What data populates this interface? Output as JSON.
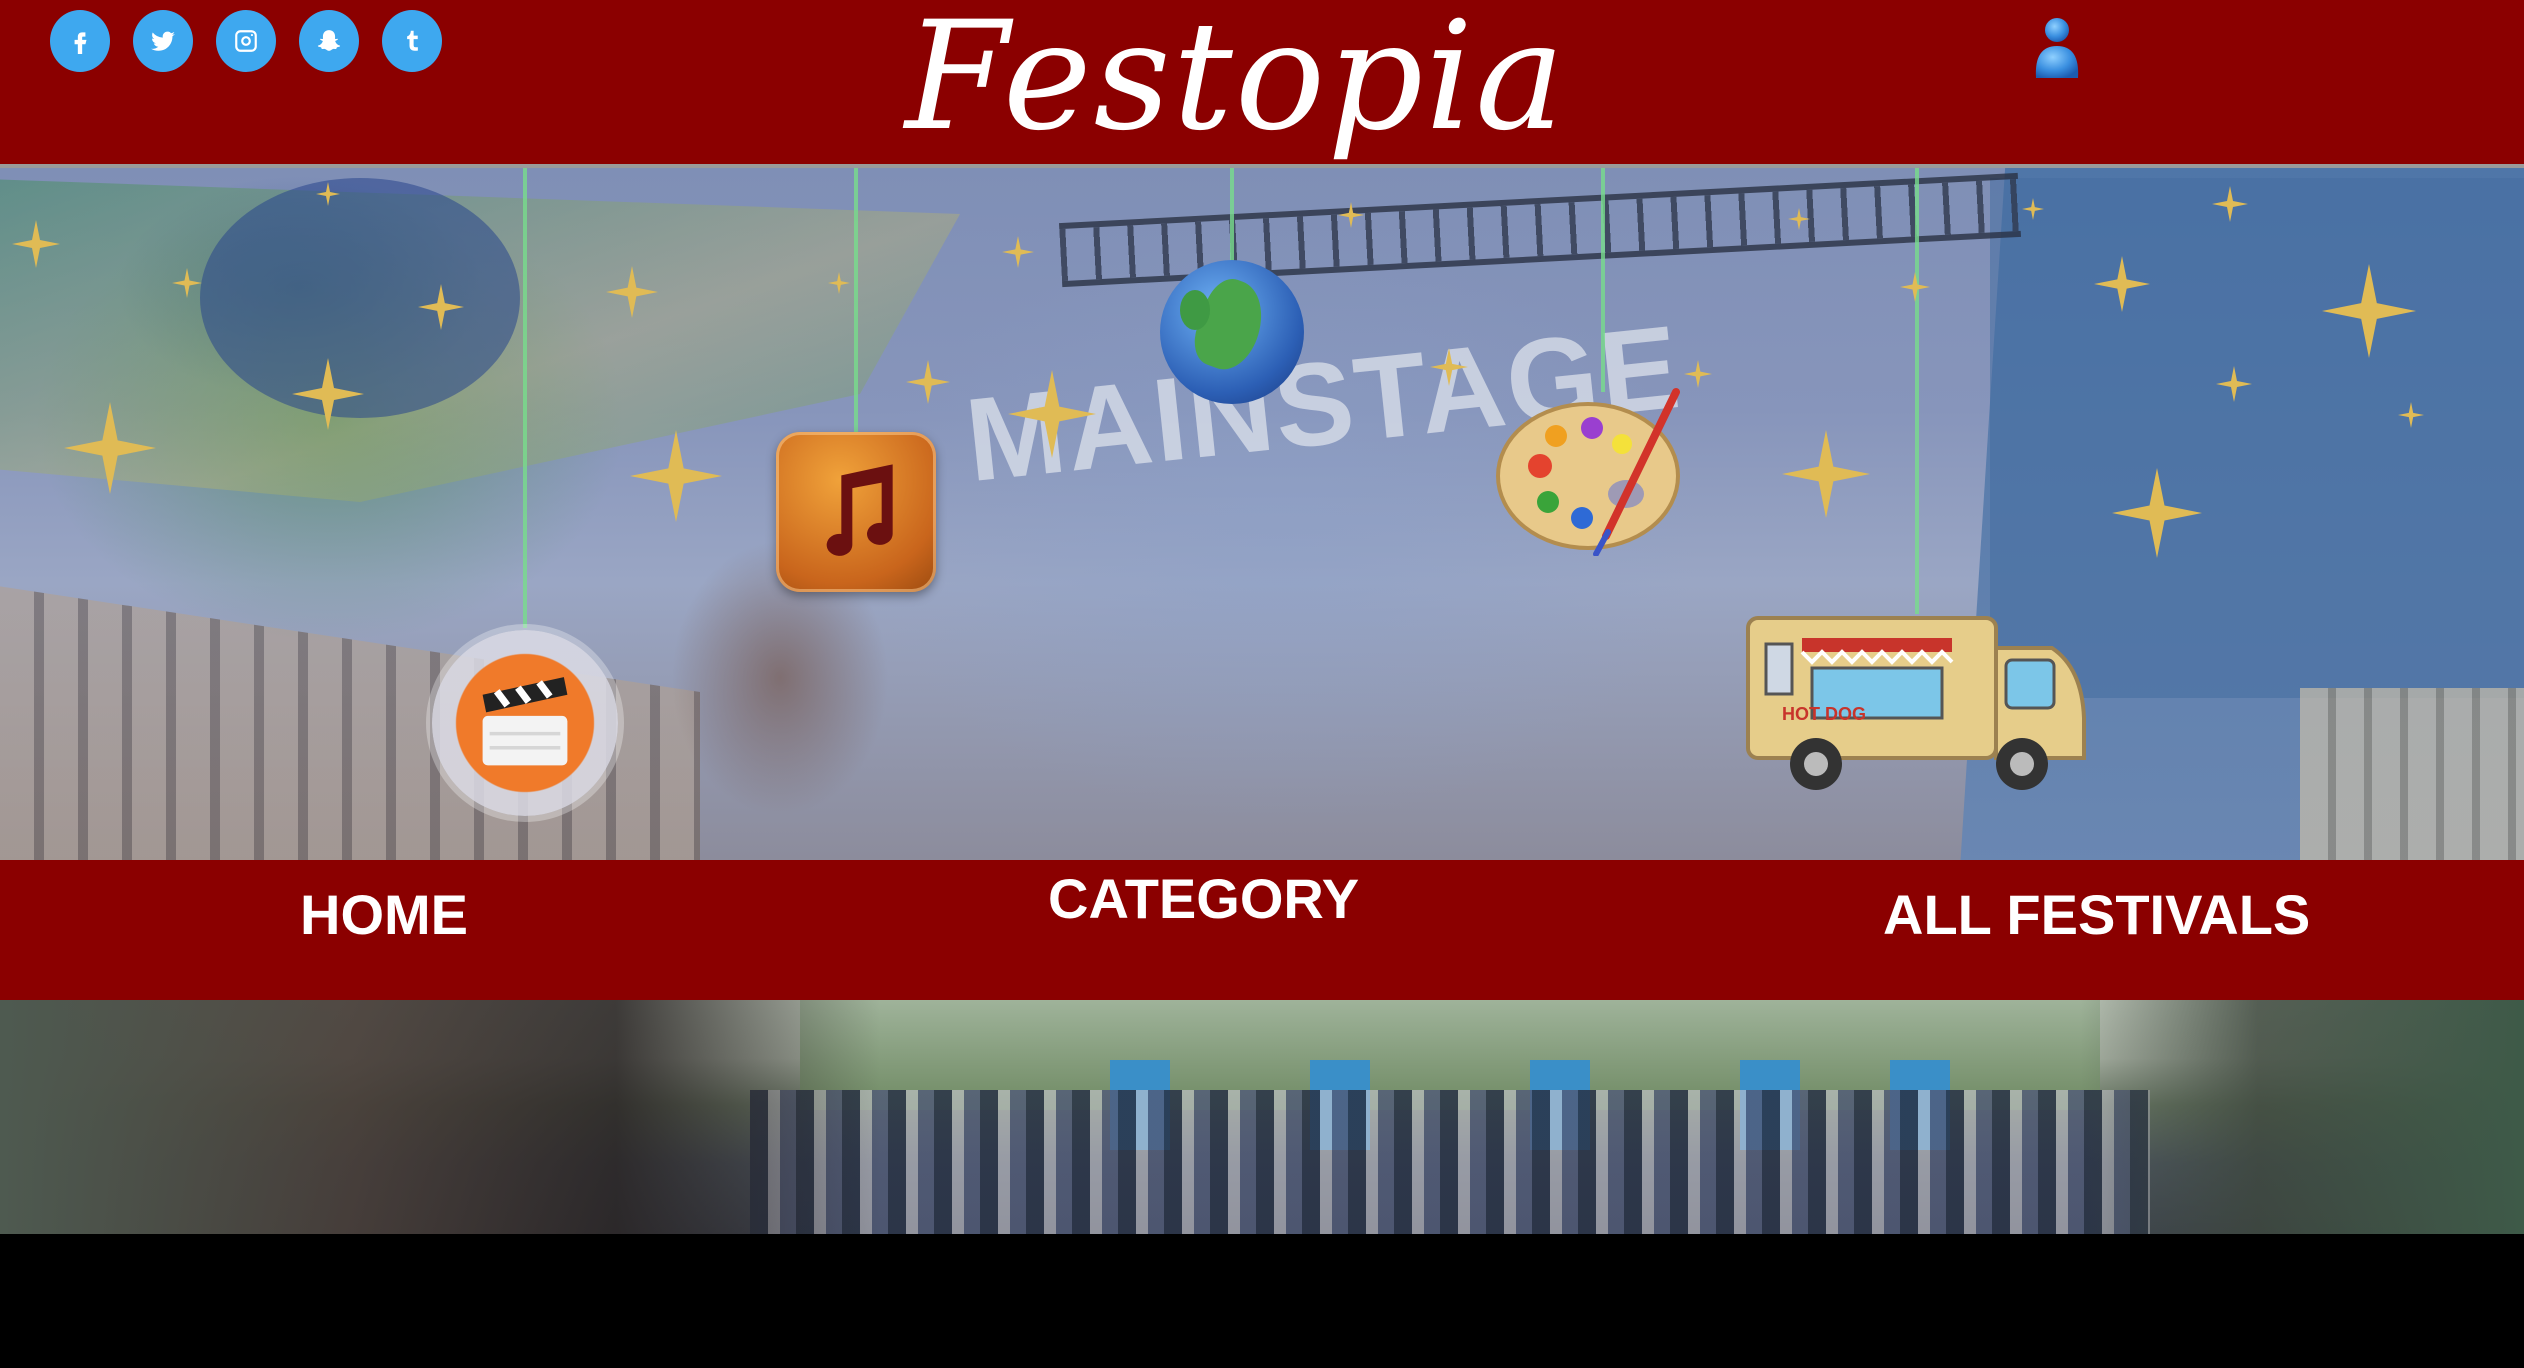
{
  "header": {
    "brand": "Festopia",
    "social_icons": [
      "facebook-icon",
      "twitter-icon",
      "instagram-icon",
      "snapchat-icon",
      "tumblr-icon"
    ],
    "user_icon": "user-icon"
  },
  "hero": {
    "banner_text": "MAINSTAGE",
    "category_icons": [
      "film-icon",
      "music-icon",
      "globe-icon",
      "palette-icon",
      "food-truck-icon"
    ],
    "truck_text": "HOT DOG"
  },
  "nav": {
    "home": "HOME",
    "category": "CATEGORY",
    "all_festivals": "ALL FESTIVALS"
  },
  "colors": {
    "header_bg": "#8b0000",
    "social_bg": "#3ea8ef",
    "nav_text": "#ffffff"
  }
}
